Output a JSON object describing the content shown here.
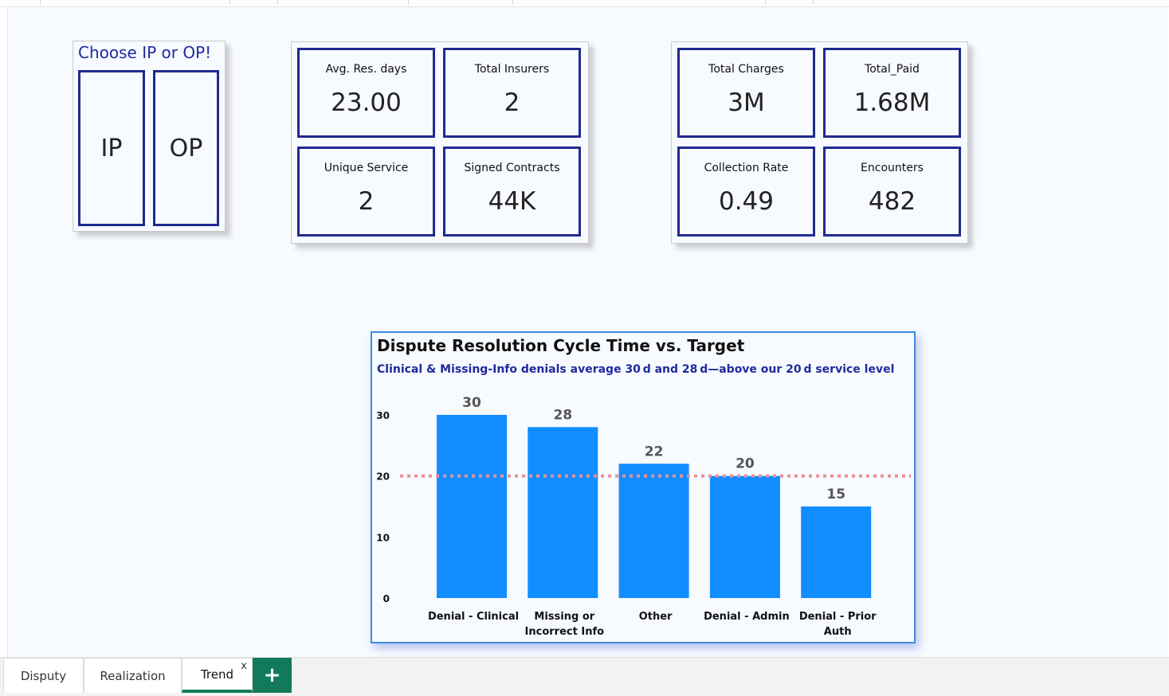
{
  "slicer": {
    "title": "Choose IP or OP!",
    "options": [
      "IP",
      "OP"
    ]
  },
  "kpis_left": [
    {
      "label": "Avg. Res. days",
      "value": "23.00"
    },
    {
      "label": "Total Insurers",
      "value": "2"
    },
    {
      "label": "Unique Service",
      "value": "2"
    },
    {
      "label": "Signed Contracts",
      "value": "44K"
    }
  ],
  "kpis_right": [
    {
      "label": "Total Charges",
      "value": "3M"
    },
    {
      "label": "Total_Paid",
      "value": "1.68M"
    },
    {
      "label": "Collection Rate",
      "value": "0.49"
    },
    {
      "label": "Encounters",
      "value": "482"
    }
  ],
  "chart_data": {
    "type": "bar",
    "title": "Dispute Resolution Cycle Time vs. Target",
    "subtitle": "Clinical & Missing-Info denials average 30 d and 28 d—above our 20 d service level",
    "categories": [
      [
        "Denial - Clinical"
      ],
      [
        "Missing or",
        "Incorrect Info"
      ],
      [
        "Other"
      ],
      [
        "Denial - Admin"
      ],
      [
        "Denial - Prior",
        "Auth"
      ]
    ],
    "values": [
      30,
      28,
      22,
      20,
      15
    ],
    "yticks": [
      0,
      10,
      20,
      30
    ],
    "ylim": [
      0,
      30
    ],
    "target": 20,
    "bar_color": "#118DFF",
    "target_color": "#e8909c",
    "grid": false
  },
  "tabs": {
    "items": [
      "Disputy",
      "Realization",
      "Trend"
    ],
    "active": "Trend",
    "close_label": "x",
    "add_label": "+"
  },
  "colors": {
    "accent": "#1f2a8f",
    "tab_accent": "#127a5b",
    "background": "#f7faff"
  }
}
